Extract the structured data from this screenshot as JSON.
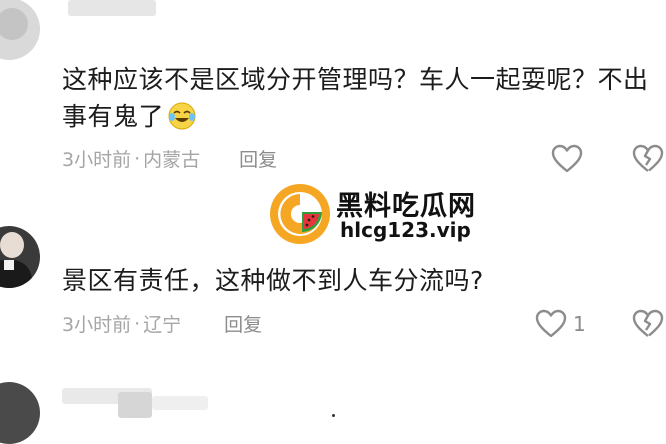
{
  "colors": {
    "text": "#1c1c1c",
    "meta": "#a5a5a5",
    "icon": "#8c8c8c",
    "watermark_orange": "#f5a623"
  },
  "comments": [
    {
      "text": "这种应该不是区域分开管理吗？车人一起耍呢？不出事有鬼了",
      "emoji": "crying-laughing-emoji",
      "time": "3小时前",
      "separator": "·",
      "location": "内蒙古",
      "reply_label": "回复",
      "like_icon": "heart-outline-icon",
      "dislike_icon": "broken-heart-icon"
    },
    {
      "text": "景区有责任，这种做不到人车分流吗?",
      "time": "3小时前",
      "separator": "·",
      "location": "辽宁",
      "reply_label": "回复",
      "like_count": "1",
      "like_icon": "heart-outline-icon",
      "dislike_icon": "broken-heart-icon"
    }
  ],
  "watermark": {
    "title": "黑料吃瓜网",
    "url": "hlcg123.vip"
  }
}
